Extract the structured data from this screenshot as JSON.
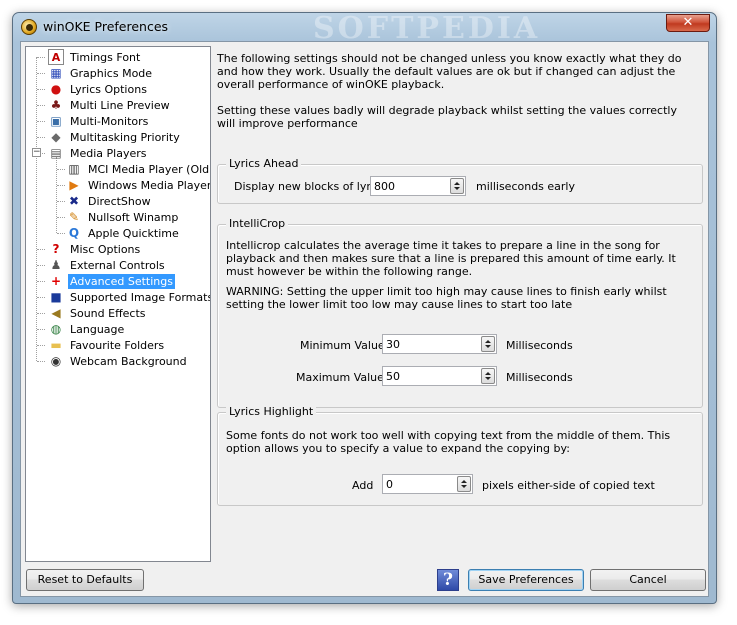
{
  "window": {
    "title": "winOKE Preferences",
    "watermark": "SOFTPEDIA",
    "close_glyph": "✕"
  },
  "tree": {
    "items": [
      {
        "label": "Timings Font",
        "icon": "font-icon"
      },
      {
        "label": "Graphics Mode",
        "icon": "graphics-icon"
      },
      {
        "label": "Lyrics Options",
        "icon": "lyrics-icon"
      },
      {
        "label": "Multi Line Preview",
        "icon": "preview-icon"
      },
      {
        "label": "Multi-Monitors",
        "icon": "monitors-icon"
      },
      {
        "label": "Multitasking Priority",
        "icon": "priority-icon"
      },
      {
        "label": "Media Players",
        "icon": "media-players-icon",
        "expanded": true
      },
      {
        "label": "MCI Media Player (Old)",
        "icon": "mci-icon",
        "child": true
      },
      {
        "label": "Windows Media Player",
        "icon": "wmp-icon",
        "child": true
      },
      {
        "label": "DirectShow",
        "icon": "directshow-icon",
        "child": true
      },
      {
        "label": "Nullsoft Winamp",
        "icon": "winamp-icon",
        "child": true
      },
      {
        "label": "Apple Quicktime",
        "icon": "quicktime-icon",
        "child": true
      },
      {
        "label": "Misc Options",
        "icon": "question-icon"
      },
      {
        "label": "External Controls",
        "icon": "joystick-icon"
      },
      {
        "label": "Advanced Settings",
        "icon": "plus-icon",
        "selected": true
      },
      {
        "label": "Supported Image Formats",
        "icon": "image-icon"
      },
      {
        "label": "Sound Effects",
        "icon": "sound-icon"
      },
      {
        "label": "Language",
        "icon": "globe-icon"
      },
      {
        "label": "Favourite Folders",
        "icon": "folder-icon"
      },
      {
        "label": "Webcam Background",
        "icon": "webcam-icon"
      }
    ]
  },
  "intro": {
    "p1": "The following settings should not be changed unless you know exactly what they do and how they work.  Usually the default values are ok but if changed can adjust the overall performance of winOKE playback.",
    "p2": "Setting these values badly will degrade playback whilst setting the values correctly will improve performance"
  },
  "lyrics_ahead": {
    "title": "Lyrics Ahead",
    "label": "Display new blocks of lyrics:",
    "value": "800",
    "unit": "milliseconds early"
  },
  "intellicrop": {
    "title": "IntelliCrop",
    "desc": "Intellicrop calculates the average time it takes to prepare a line in the song for playback and then makes sure that a line is prepared this amount of time early.  It must however be within the following range.",
    "warning": "WARNING: Setting the upper limit too high may cause lines to finish early whilst setting the lower limit too low may cause lines to start too late",
    "min_label": "Minimum Value:",
    "min_value": "30",
    "max_label": "Maximum Value:",
    "max_value": "50",
    "unit": "Milliseconds"
  },
  "lyrics_highlight": {
    "title": "Lyrics Highlight",
    "desc": "Some fonts do not work too well with copying text from the middle of them.  This option allows you to specify a value to expand the copying by:",
    "label": "Add",
    "value": "0",
    "unit": "pixels either-side of copied text"
  },
  "buttons": {
    "reset": "Reset to Defaults",
    "help": "?",
    "save": "Save Preferences",
    "cancel": "Cancel"
  },
  "colors": {
    "selection": "#3399ff",
    "dialog_bg": "#f0f0f0"
  }
}
